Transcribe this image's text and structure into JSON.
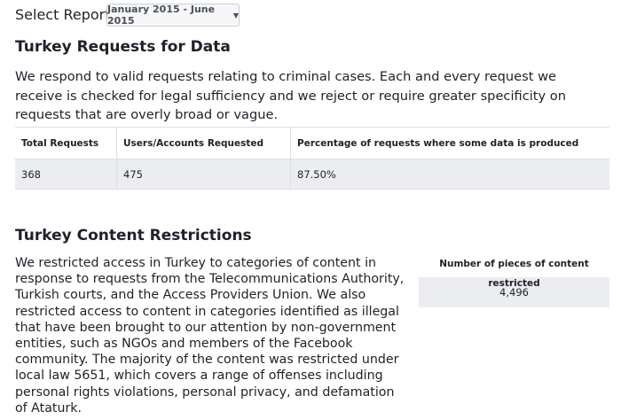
{
  "header": {
    "select_label": "Select Report",
    "report_dropdown": {
      "selected": "January 2015 - June 2015"
    }
  },
  "requests_section": {
    "title": "Turkey Requests for Data",
    "description": "We respond to valid requests relating to criminal cases. Each and every request we receive is checked for legal sufficiency and we reject or require greater specificity on requests that are overly broad or vague.",
    "table": {
      "columns": [
        "Total Requests",
        "Users/Accounts Requested",
        "Percentage of requests where some data is produced"
      ],
      "rows": [
        [
          "368",
          "475",
          "87.50%"
        ]
      ]
    }
  },
  "restrictions_section": {
    "title": "Turkey Content Restrictions",
    "description": "We restricted access in Turkey to categories of content in response to requests from the Telecommunications Authority, Turkish courts, and the Access Providers Union. We also restricted access to content in categories identified as illegal that have been brought to our attention by non-government entities, such as NGOs and members of the Facebook community. The majority of the content was restricted under local law 5651, which covers a range of offenses including personal rights violations, personal privacy, and defamation of Ataturk.",
    "stat": {
      "label": "Number of pieces of content restricted",
      "value": "4,496"
    }
  },
  "colors": {
    "text": "#1d2129",
    "cell_background": "#ebedf0",
    "border": "#dddfe2",
    "dropdown_background": "#f6f7f9"
  }
}
